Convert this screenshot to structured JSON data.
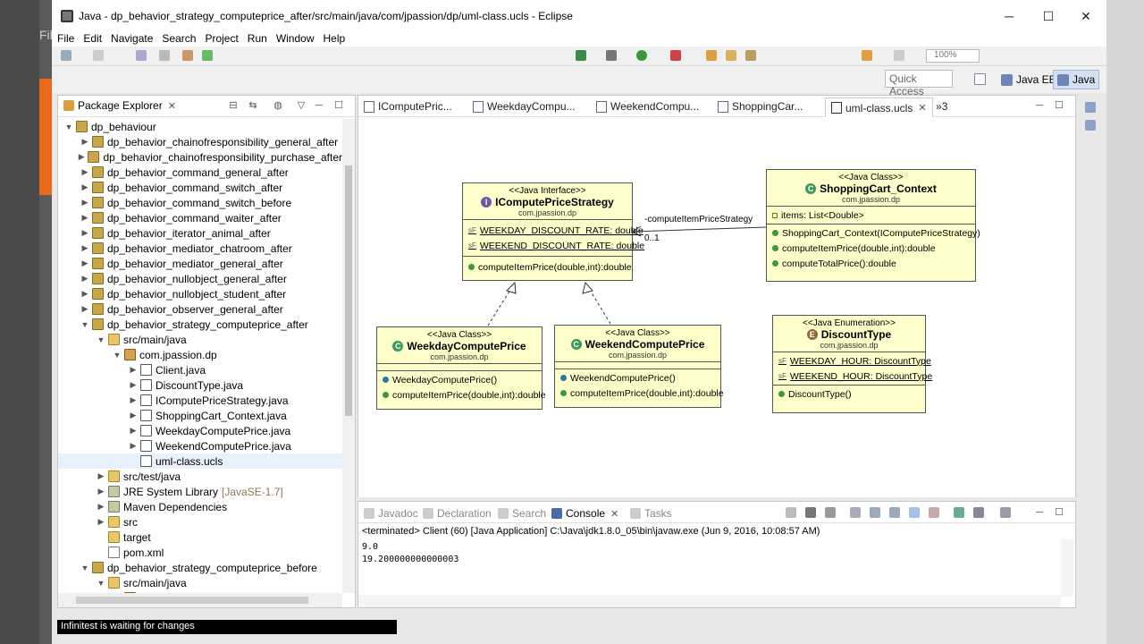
{
  "window": {
    "title": "Java - dp_behavior_strategy_computeprice_after/src/main/java/com/jpassion/dp/uml-class.ucls - Eclipse",
    "minimize": "─",
    "maximize": "☐",
    "close": "✕"
  },
  "background": {
    "partial_menu": "Fil"
  },
  "menu": [
    "File",
    "Edit",
    "Navigate",
    "Search",
    "Project",
    "Run",
    "Window",
    "Help"
  ],
  "toolbar": {
    "zoom": "100%",
    "quick_access_placeholder": "Quick Access",
    "perspectives": [
      "Java EE",
      "Java"
    ]
  },
  "package_explorer": {
    "tab_label": "Package Explorer",
    "tree": [
      {
        "label": "dp_behaviour",
        "depth": 0,
        "expanded": true,
        "icon": "project-icon"
      },
      {
        "label": "dp_behavior_chainofresponsibility_general_after",
        "depth": 1,
        "expanded": false,
        "icon": "project-icon"
      },
      {
        "label": "dp_behavior_chainofresponsibility_purchase_after",
        "depth": 1,
        "expanded": false,
        "icon": "project-icon"
      },
      {
        "label": "dp_behavior_command_general_after",
        "depth": 1,
        "expanded": false,
        "icon": "project-icon"
      },
      {
        "label": "dp_behavior_command_switch_after",
        "depth": 1,
        "expanded": false,
        "icon": "project-icon"
      },
      {
        "label": "dp_behavior_command_switch_before",
        "depth": 1,
        "expanded": false,
        "icon": "project-icon"
      },
      {
        "label": "dp_behavior_command_waiter_after",
        "depth": 1,
        "expanded": false,
        "icon": "project-icon"
      },
      {
        "label": "dp_behavior_iterator_animal_after",
        "depth": 1,
        "expanded": false,
        "icon": "project-icon"
      },
      {
        "label": "dp_behavior_mediator_chatroom_after",
        "depth": 1,
        "expanded": false,
        "icon": "project-icon"
      },
      {
        "label": "dp_behavior_mediator_general_after",
        "depth": 1,
        "expanded": false,
        "icon": "project-icon"
      },
      {
        "label": "dp_behavior_nullobject_general_after",
        "depth": 1,
        "expanded": false,
        "icon": "project-icon"
      },
      {
        "label": "dp_behavior_nullobject_student_after",
        "depth": 1,
        "expanded": false,
        "icon": "project-icon"
      },
      {
        "label": "dp_behavior_observer_general_after",
        "depth": 1,
        "expanded": false,
        "icon": "project-icon"
      },
      {
        "label": "dp_behavior_strategy_computeprice_after",
        "depth": 1,
        "expanded": true,
        "icon": "project-icon"
      },
      {
        "label": "src/main/java",
        "depth": 2,
        "expanded": true,
        "icon": "source-folder-icon"
      },
      {
        "label": "com.jpassion.dp",
        "depth": 3,
        "expanded": true,
        "icon": "package-icon"
      },
      {
        "label": "Client.java",
        "depth": 4,
        "expanded": false,
        "icon": "java-file-icon"
      },
      {
        "label": "DiscountType.java",
        "depth": 4,
        "expanded": false,
        "icon": "java-file-icon"
      },
      {
        "label": "IComputePriceStrategy.java",
        "depth": 4,
        "expanded": false,
        "icon": "java-file-icon"
      },
      {
        "label": "ShoppingCart_Context.java",
        "depth": 4,
        "expanded": false,
        "icon": "java-file-icon"
      },
      {
        "label": "WeekdayComputePrice.java",
        "depth": 4,
        "expanded": false,
        "icon": "java-file-icon"
      },
      {
        "label": "WeekendComputePrice.java",
        "depth": 4,
        "expanded": false,
        "icon": "java-file-icon"
      },
      {
        "label": "uml-class.ucls",
        "depth": 4,
        "expanded": null,
        "icon": "ucls-file-icon",
        "selected": true
      },
      {
        "label": "src/test/java",
        "depth": 2,
        "expanded": false,
        "icon": "source-folder-icon"
      },
      {
        "label": "JRE System Library",
        "suffix": "[JavaSE-1.7]",
        "depth": 2,
        "expanded": false,
        "icon": "library-icon"
      },
      {
        "label": "Maven Dependencies",
        "depth": 2,
        "expanded": false,
        "icon": "library-icon"
      },
      {
        "label": "src",
        "depth": 2,
        "expanded": false,
        "icon": "folder-icon"
      },
      {
        "label": "target",
        "depth": 2,
        "expanded": null,
        "icon": "folder-icon"
      },
      {
        "label": "pom.xml",
        "depth": 2,
        "expanded": null,
        "icon": "xml-file-icon"
      },
      {
        "label": "dp_behavior_strategy_computeprice_before",
        "depth": 1,
        "expanded": true,
        "icon": "project-icon"
      },
      {
        "label": "src/main/java",
        "depth": 2,
        "expanded": true,
        "icon": "source-folder-icon"
      },
      {
        "label": "com.jpassion.dp",
        "depth": 3,
        "expanded": false,
        "icon": "package-icon"
      }
    ]
  },
  "editor": {
    "tabs": [
      "IComputePric...",
      "WeekdayCompu...",
      "WeekendCompu...",
      "ShoppingCar...",
      "uml-class.ucls"
    ],
    "active_tab": "uml-class.ucls",
    "overflow_count": "3",
    "diagram": {
      "iface": {
        "stereotype": "<<Java Interface>>",
        "name": "IComputePriceStrategy",
        "pkg": "com.jpassion.dp",
        "fields": [
          "WEEKDAY_DISCOUNT_RATE: double",
          "WEEKEND_DISCOUNT_RATE: double"
        ],
        "methods": [
          "computeItemPrice(double,int):double"
        ]
      },
      "cart": {
        "stereotype": "<<Java Class>>",
        "name": "ShoppingCart_Context",
        "pkg": "com.jpassion.dp",
        "fields": [
          "items: List<Double>"
        ],
        "methods": [
          "ShoppingCart_Context(IComputePriceStrategy)",
          "computeItemPrice(double,int):double",
          "computeTotalPrice():double"
        ]
      },
      "weekday": {
        "stereotype": "<<Java Class>>",
        "name": "WeekdayComputePrice",
        "pkg": "com.jpassion.dp",
        "methods": [
          "WeekdayComputePrice()",
          "computeItemPrice(double,int):double"
        ]
      },
      "weekend": {
        "stereotype": "<<Java Class>>",
        "name": "WeekendComputePrice",
        "pkg": "com.jpassion.dp",
        "methods": [
          "WeekendComputePrice()",
          "computeItemPrice(double,int):double"
        ]
      },
      "enum": {
        "stereotype": "<<Java Enumeration>>",
        "name": "DiscountType",
        "pkg": "com.jpassion.dp",
        "fields": [
          "WEEKDAY_HOUR: DiscountType",
          "WEEKEND_HOUR: DiscountType"
        ],
        "methods": [
          "DiscountType()"
        ]
      },
      "association": {
        "role": "-computeItemPriceStrategy",
        "multiplicity": "0..1"
      }
    }
  },
  "console": {
    "tabs": [
      "Javadoc",
      "Declaration",
      "Search",
      "Console",
      "Tasks"
    ],
    "active_tab": "Console",
    "header": "<terminated> Client (60) [Java Application] C:\\Java\\jdk1.8.0_05\\bin\\javaw.exe (Jun 9, 2016, 10:08:57 AM)",
    "output": [
      "9.0",
      "19.200000000000003"
    ]
  },
  "status": {
    "message": "Infinitest is waiting for changes"
  },
  "colors": {
    "uml_fill": "#ffffcc",
    "selection": "#e8f0fb",
    "method_dot": "#3a9a3a",
    "interface_icon": "#6a5aa8",
    "class_icon": "#3a9a5a",
    "enum_icon": "#8a6a3a"
  }
}
